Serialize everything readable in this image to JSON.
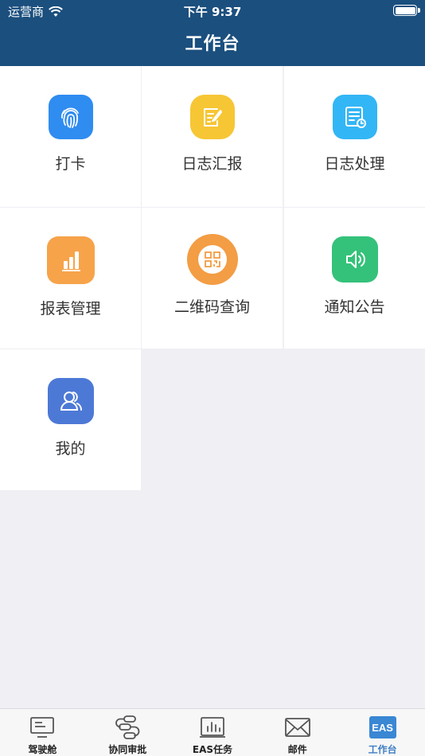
{
  "status_bar": {
    "carrier": "运营商",
    "time": "下午 9:37"
  },
  "nav": {
    "title": "工作台"
  },
  "grid": [
    {
      "label": "打卡",
      "icon": "fingerprint-icon",
      "color": "#2f8cf0"
    },
    {
      "label": "日志汇报",
      "icon": "note-edit-icon",
      "color": "#f6c635"
    },
    {
      "label": "日志处理",
      "icon": "doc-clock-icon",
      "color": "#33b6f5"
    },
    {
      "label": "报表管理",
      "icon": "bar-chart-icon",
      "color": "#f7a34a"
    },
    {
      "label": "二维码查询",
      "icon": "qr-code-icon",
      "color": "#f39d44"
    },
    {
      "label": "通知公告",
      "icon": "speaker-icon",
      "color": "#34c27a"
    },
    {
      "label": "我的",
      "icon": "users-icon",
      "color": "#4d79d6"
    }
  ],
  "tabbar": {
    "items": [
      {
        "label": "驾驶舱",
        "icon": "monitor-icon"
      },
      {
        "label": "协同审批",
        "icon": "flow-icon"
      },
      {
        "label": "EAS任务",
        "icon": "chart-board-icon"
      },
      {
        "label": "邮件",
        "icon": "mail-icon"
      },
      {
        "label": "工作台",
        "icon": "eas-icon",
        "badge_text": "EAS"
      }
    ],
    "active_index": 4
  },
  "colors": {
    "header_bg": "#1b4f7e",
    "tab_active": "#3f7ec5",
    "page_bg": "#efeff4"
  }
}
